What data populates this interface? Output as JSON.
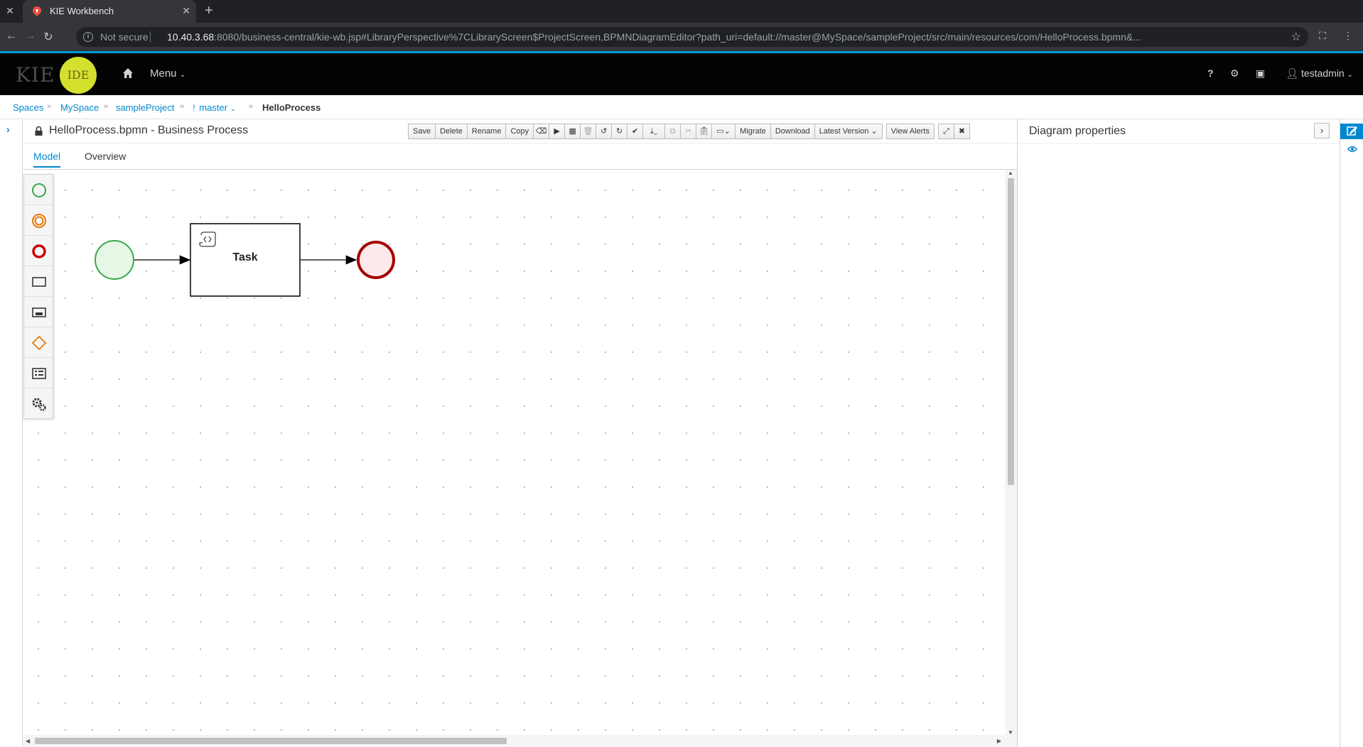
{
  "browser": {
    "tab_title": "KIE Workbench",
    "new_tab_symbol": "+",
    "not_secure": "Not secure",
    "url_host": "10.40.3.68",
    "url_rest": ":8080/business-central/kie-wb.jsp#LibraryPerspective%7CLibraryScreen$ProjectScreen,BPMNDiagramEditor?path_uri=default://master@MySpace/sampleProject/src/main/resources/com/HelloProcess.bpmn&..."
  },
  "header": {
    "logo_left": "KIE",
    "logo_right": "IDE",
    "menu_label": "Menu",
    "user_label": "testadmin"
  },
  "breadcrumb": {
    "spaces": "Spaces",
    "space": "MySpace",
    "project": "sampleProject",
    "branch": "master",
    "current": "HelloProcess"
  },
  "editor": {
    "title": "HelloProcess.bpmn - Business Process",
    "toolbar": {
      "save": "Save",
      "delete": "Delete",
      "rename": "Rename",
      "copy": "Copy",
      "migrate": "Migrate",
      "download": "Download",
      "latest_version": "Latest Version",
      "view_alerts": "View Alerts"
    },
    "tabs": {
      "model": "Model",
      "overview": "Overview"
    },
    "diagram": {
      "task_label": "Task"
    }
  },
  "properties": {
    "title": "Diagram properties"
  },
  "colors": {
    "accent": "#0088ce",
    "header_bg": "#030303",
    "start_event": "#3fa54e",
    "end_event": "#a30000",
    "gateway": "#ec7a08",
    "logo_circle": "#d4e02e"
  }
}
